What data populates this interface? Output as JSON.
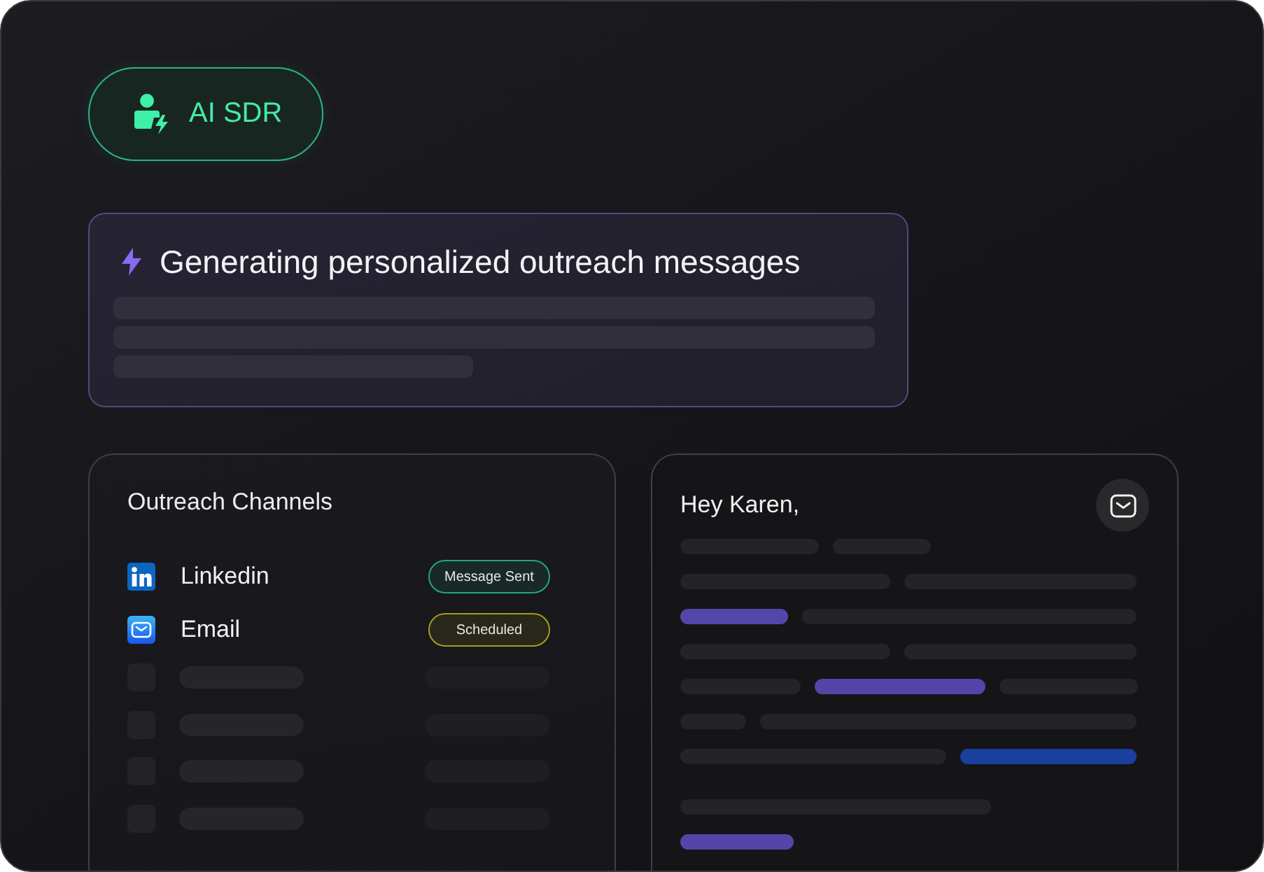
{
  "agent_badge": {
    "label": "AI SDR"
  },
  "generating_card": {
    "title": "Generating personalized outreach messages"
  },
  "channels_card": {
    "title": "Outreach Channels",
    "channels": [
      {
        "kind": "linkedin",
        "name": "Linkedin",
        "status": "Message Sent",
        "color": "#22a877"
      },
      {
        "kind": "email",
        "name": "Email",
        "status": "Scheduled",
        "color": "#a89c1c"
      }
    ]
  },
  "email_card": {
    "greeting": "Hey Karen,"
  }
}
